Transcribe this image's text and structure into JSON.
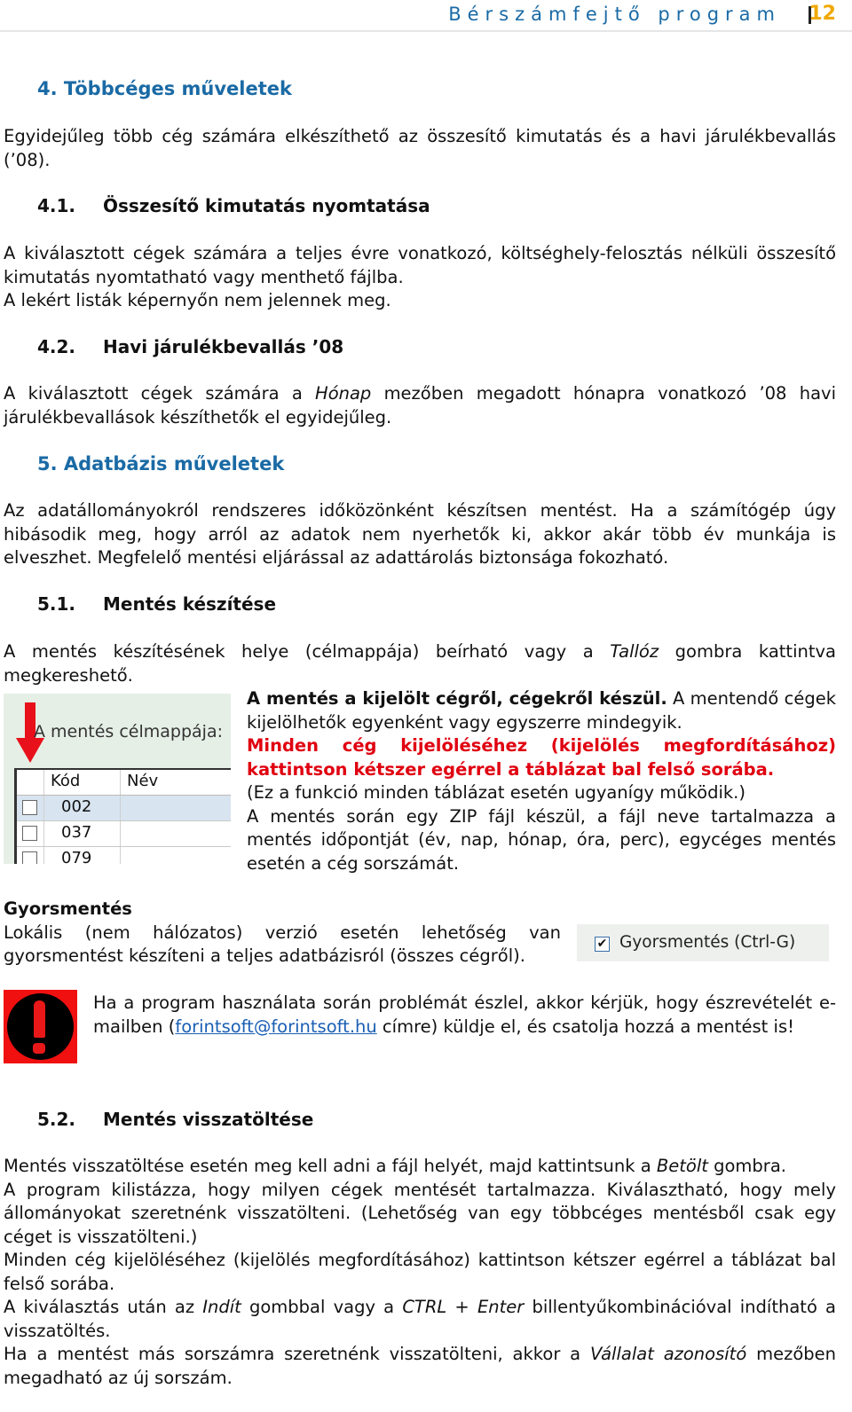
{
  "header": {
    "title": "Bérszámfejtő program",
    "page_number": "12"
  },
  "sections": {
    "s4": {
      "heading": "4.  Többcéges műveletek",
      "intro": "Egyidejűleg több cég számára elkészíthető az összesítő kimutatás és a havi járulékbevallás (’08)."
    },
    "s4_1": {
      "num": "4.1.",
      "title": "Összesítő kimutatás nyomtatása",
      "body": "A kiválasztott cégek számára a teljes évre vonatkozó, költséghely-felosztás nélküli összesítő kimutatás nyomtatható vagy menthető fájlba.",
      "body2": "A lekért listák képernyőn nem jelennek meg."
    },
    "s4_2": {
      "num": "4.2.",
      "title": "Havi járulékbevallás ’08",
      "body_pre": "A kiválasztott cégek számára a ",
      "body_em": "Hónap",
      "body_post": " mezőben megadott hónapra vonatkozó ’08 havi járulékbevallások készíthetők el egyidejűleg."
    },
    "s5": {
      "heading": "5.  Adatbázis műveletek",
      "body": "Az adatállományokról rendszeres időközönként készítsen mentést. Ha a számítógép úgy hibásodik meg, hogy arról az adatok nem nyerhetők ki, akkor akár több év munkája is elveszhet. Megfelelő mentési eljárással az adattárolás biztonsága fokozható."
    },
    "s5_1": {
      "num": "5.1.",
      "title": "Mentés készítése",
      "body_pre": "A mentés készítésének helye (célmappája) beírható vagy a ",
      "body_em": "Tallóz",
      "body_post": " gombra kattintva megkereshető.",
      "bold_lead": "A mentés a kijelölt cégről, cégekről készül.",
      "after_bold": " A mentendő cégek kijelölhetők egyenként vagy egyszerre mindegyik.",
      "red_note": "Minden cég kijelöléséhez (kijelölés megfordításához) kattintson kétszer egérrel a táblázat bal felső sorába.",
      "paren_note": "(Ez a funkció minden táblázat esetén ugyanígy működik.)",
      "zip_note": "A mentés során egy ZIP fájl készül, a fájl neve tartalmazza a mentés időpontját (év, nap, hónap, óra, perc), egycéges mentés esetén a cég sorszámát."
    },
    "screenshot": {
      "label": "A mentés célmappája:",
      "columns": [
        "Kód",
        "Név"
      ],
      "rows": [
        {
          "kod": "002",
          "nev": ""
        },
        {
          "kod": "037",
          "nev": ""
        },
        {
          "kod": "079",
          "nev": ""
        }
      ]
    },
    "gyorsmentes": {
      "title": "Gyorsmentés",
      "body": "Lokális (nem hálózatos) verzió esetén lehetőség van gyorsmentést készíteni a teljes adatbázisról (összes cégről).",
      "checkbox_label": "Gyorsmentés (Ctrl-G)",
      "checked": true
    },
    "warning": {
      "pre": "Ha a program használata során problémát észlel, akkor kérjük, hogy észrevételét e-mailben (",
      "email": "forintsoft@forintsoft.hu",
      "post": " címre) küldje el, és csatolja hozzá a mentést is!"
    },
    "s5_2": {
      "num": "5.2.",
      "title": "Mentés visszatöltése",
      "p1_pre": "Mentés visszatöltése esetén meg kell adni a fájl helyét, majd kattintsunk a ",
      "p1_em": "Betölt",
      "p1_post": " gombra.",
      "p2": "A program kilistázza, hogy milyen cégek mentését tartalmazza. Kiválasztható, hogy mely állományokat szeretnénk visszatölteni. (Lehetőség van egy többcéges mentésből csak egy céget is visszatölteni.)",
      "p3": "Minden cég kijelöléséhez (kijelölés megfordításához) kattintson kétszer egérrel a táblázat bal felső sorába.",
      "p4_a": "A kiválasztás után az ",
      "p4_em1": "Indít",
      "p4_b": " gombbal vagy a ",
      "p4_em2": "CTRL + Enter",
      "p4_c": " billentyűkombinációval indítható a visszatöltés.",
      "p5_a": "Ha a mentést más sorszámra szeretnénk visszatölteni, akkor a ",
      "p5_em": "Vállalat azonosító",
      "p5_b": " mezőben megadható az új sorszám."
    }
  }
}
